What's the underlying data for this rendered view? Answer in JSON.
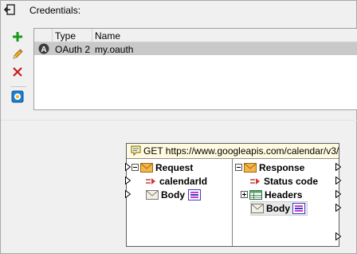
{
  "window": {
    "title": "Credentials:"
  },
  "toolbar": {
    "add_icon": "plus-icon",
    "edit_icon": "pencil-icon",
    "delete_icon": "x-icon",
    "assign_icon": "assign-credential-icon"
  },
  "table": {
    "columns": [
      "Type",
      "Name"
    ],
    "rows": [
      {
        "badge": "A",
        "type": "OAuth 2",
        "name": "my.oauth"
      }
    ]
  },
  "component": {
    "title": "GET https://www.googleapis.com/calendar/v3/",
    "request": {
      "root": "Request",
      "param": "calendarId",
      "body": "Body"
    },
    "response": {
      "root": "Response",
      "status": "Status code",
      "headers": "Headers",
      "body": "Body"
    }
  },
  "colors": {
    "add": "#1a9a1a",
    "delete": "#c81e1e",
    "selected_row": "#c9c9c9",
    "component_header": "#fffbe0"
  }
}
